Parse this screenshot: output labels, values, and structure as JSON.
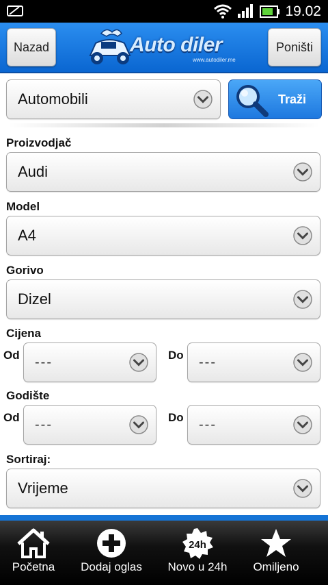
{
  "status": {
    "time": "19.02"
  },
  "header": {
    "back_label": "Nazad",
    "reset_label": "Poništi",
    "logo_text": "Auto diler",
    "logo_url": "www.autodiler.me"
  },
  "category": {
    "selected": "Automobili"
  },
  "search": {
    "label": "Traži"
  },
  "fields": {
    "make": {
      "label": "Proizvodjač",
      "value": "Audi"
    },
    "model": {
      "label": "Model",
      "value": "A4"
    },
    "fuel": {
      "label": "Gorivo",
      "value": "Dizel"
    },
    "price": {
      "label": "Cijena",
      "from_label": "Od",
      "to_label": "Do",
      "from": "---",
      "to": "---"
    },
    "year": {
      "label": "Godište",
      "from_label": "Od",
      "to_label": "Do",
      "from": "---",
      "to": "---"
    },
    "sort": {
      "label": "Sortiraj:",
      "value": "Vrijeme"
    }
  },
  "nav": {
    "home": "Početna",
    "add": "Dodaj oglas",
    "new24": "Novo u 24h",
    "new24_badge": "24h",
    "favorites": "Omiljeno"
  },
  "colors": {
    "accent": "#1574d6",
    "header": "#0a66d1"
  }
}
